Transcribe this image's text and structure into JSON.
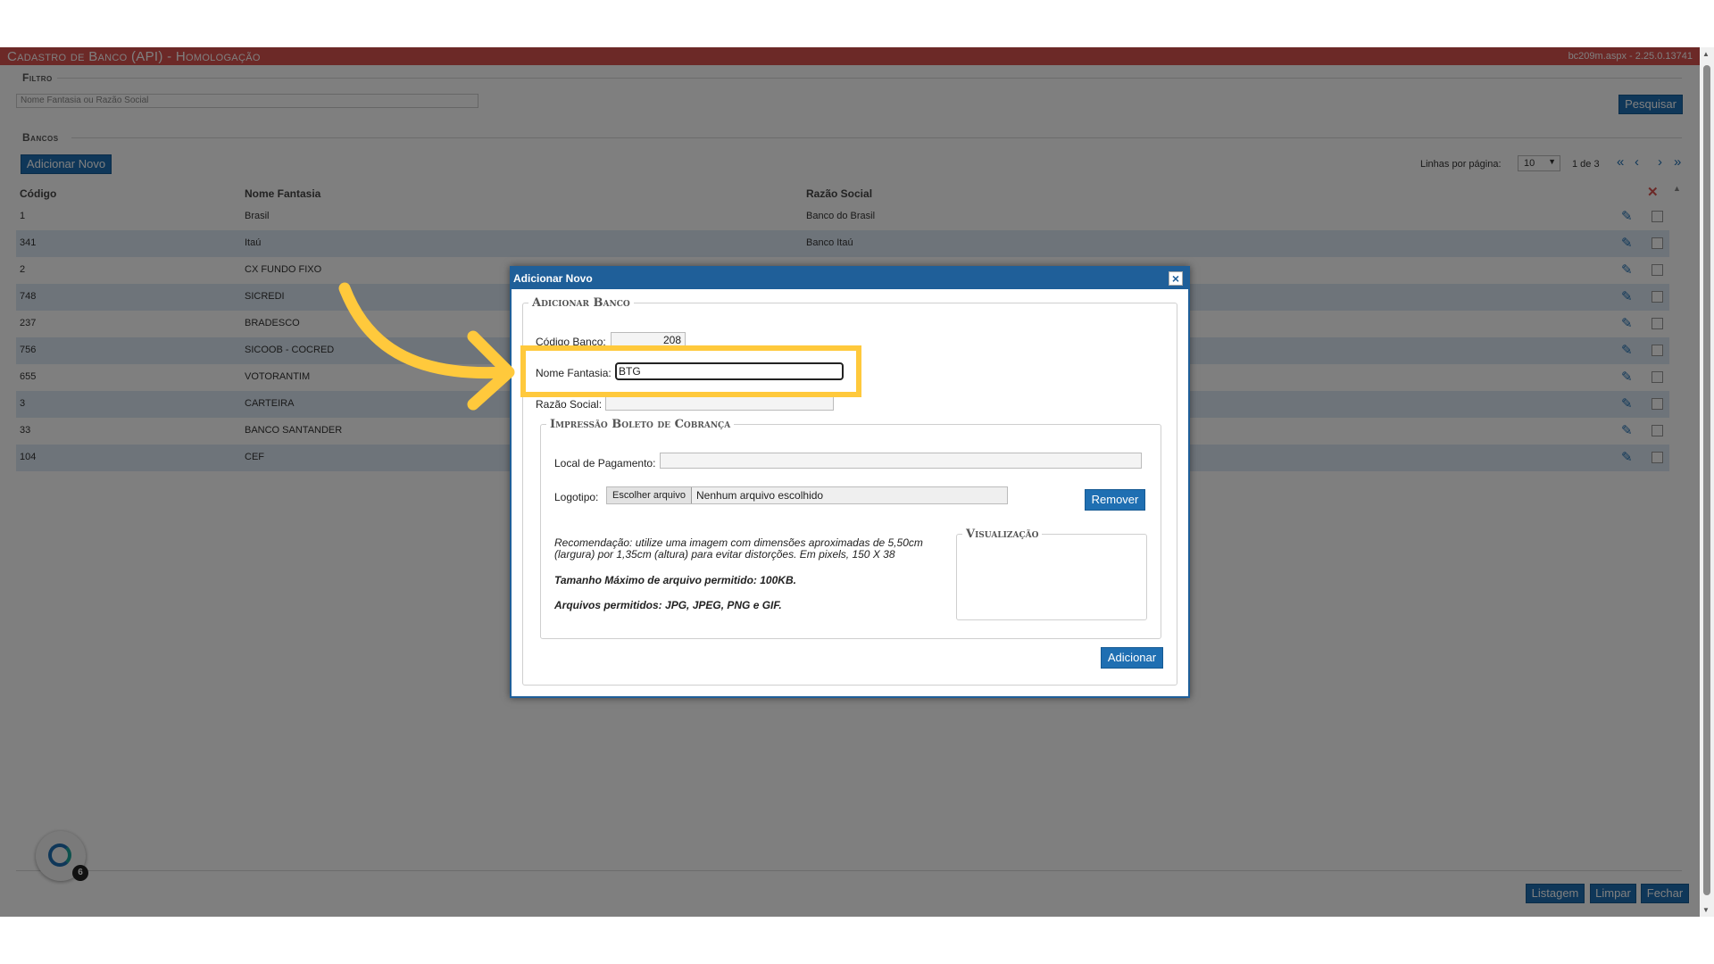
{
  "app": {
    "title": "Cadastro de Banco (API)  - Homologação",
    "version": "bc209m.aspx - 2.25.0.13741"
  },
  "filter": {
    "section_title": "Filtro",
    "search_placeholder": "Nome Fantasia ou Razão Social",
    "search_button": "Pesquisar"
  },
  "banks": {
    "section_title": "Bancos",
    "add_button": "Adicionar Novo",
    "rows_per_page_label": "Linhas por página:",
    "rows_per_page_value": "10",
    "page_info": "1 de 3",
    "columns": [
      "Código",
      "Nome Fantasia",
      "Razão Social"
    ],
    "rows": [
      {
        "codigo": "1",
        "nome": "Brasil",
        "razao": "Banco do Brasil"
      },
      {
        "codigo": "341",
        "nome": "Itaú",
        "razao": "Banco Itaú"
      },
      {
        "codigo": "2",
        "nome": "CX FUNDO FIXO",
        "razao": ""
      },
      {
        "codigo": "748",
        "nome": "SICREDI",
        "razao": ""
      },
      {
        "codigo": "237",
        "nome": "BRADESCO",
        "razao": ""
      },
      {
        "codigo": "756",
        "nome": "SICOOB - COCRED",
        "razao": ""
      },
      {
        "codigo": "655",
        "nome": "VOTORANTIM",
        "razao": ""
      },
      {
        "codigo": "3",
        "nome": "CARTEIRA",
        "razao": ""
      },
      {
        "codigo": "33",
        "nome": "BANCO SANTANDER",
        "razao": ""
      },
      {
        "codigo": "104",
        "nome": "CEF",
        "razao": ""
      }
    ]
  },
  "footer": {
    "listagem": "Listagem",
    "limpar": "Limpar",
    "fechar": "Fechar",
    "assistant_badge": "6"
  },
  "modal": {
    "title": "Adicionar Novo",
    "section_title": "Adicionar Banco",
    "codigo_label": "Código Banco:",
    "codigo_value": "208",
    "nome_label": "Nome Fantasia:",
    "nome_value": "BTG",
    "razao_label": "Razão Social:",
    "razao_value": "",
    "boleto_section": "Impressão Boleto de Cobrança",
    "local_label": "Local de Pagamento:",
    "local_value": "",
    "logo_label": "Logotipo:",
    "choose_file": "Escolher arquivo",
    "no_file": "Nenhum arquivo escolhido",
    "remove_button": "Remover",
    "recommendation_line1": "Recomendação: utilize uma imagem com dimensões aproximadas de 5,50cm",
    "recommendation_line2": "(largura) por 1,35cm (altura) para evitar distorções. Em pixels, 150 X 38",
    "max_size": "Tamanho Máximo de arquivo permitido: 100KB.",
    "allowed": "Arquivos permitidos: JPG, JPEG, PNG e GIF.",
    "preview_section": "Visualização",
    "add_button": "Adicionar"
  },
  "colors": {
    "header_red": "#d9534f",
    "primary_blue": "#1f6fb2",
    "highlight_yellow": "#ffc93c"
  }
}
